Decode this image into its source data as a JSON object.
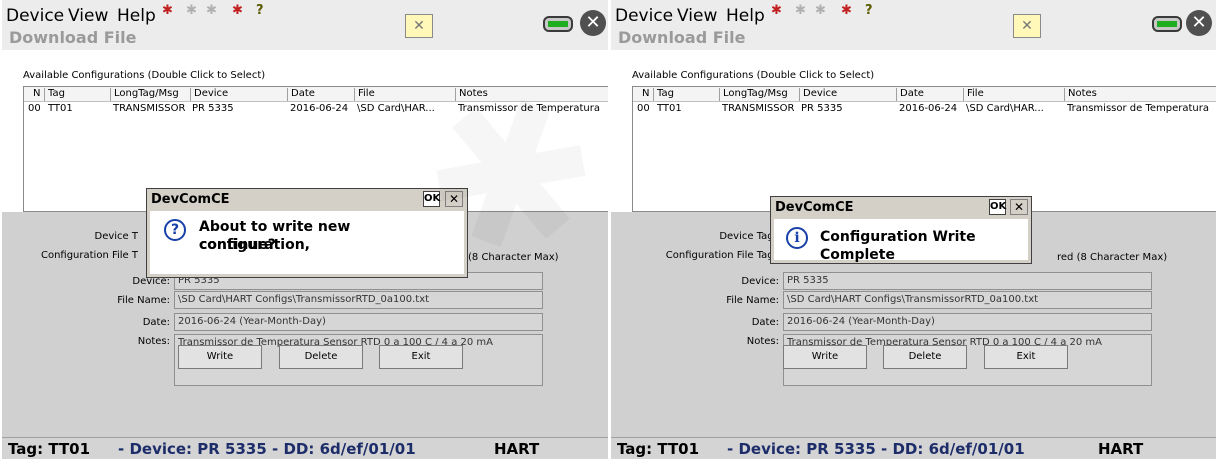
{
  "menu": {
    "device": "Device",
    "view": "View",
    "help": "Help"
  },
  "toolbar_icons": [
    "device-icon",
    "faded-icon",
    "faded-icon",
    "device-icon",
    "help-icon"
  ],
  "input_mode_symbol": "✕",
  "title": "Download File",
  "available_label": "Available Configurations (Double Click to Select)",
  "columns": [
    "N",
    "Tag",
    "LongTag/Msg",
    "Device",
    "Date",
    "File",
    "Notes"
  ],
  "row": [
    "00",
    "TT01",
    "TRANSMISSOR ...",
    "PR 5335",
    "2016-06-24",
    "\\SD Card\\HAR...",
    "Transmissor de Temperatura"
  ],
  "labels": {
    "device_tag": "Device Tag:",
    "config_file_tag": "Configuration File Tag:",
    "device": "Device:",
    "file_name": "File Name:",
    "date": "Date:",
    "notes": "Notes:"
  },
  "left_partial": {
    "device_tag": "Device T",
    "config_file_tag": "Configuration File T",
    "max_hint": "(8 Character Max)"
  },
  "right_partial": {
    "max_hint": "red (8 Character Max)"
  },
  "fields": {
    "device": "PR 5335",
    "file_name": "\\SD Card\\HART Configs\\TransmissorRTD_0a100.txt",
    "date": "2016-06-24 (Year-Month-Day)",
    "notes": "Transmissor de Temperatura Sensor RTD 0 a 100 C / 4 a 20 mA"
  },
  "buttons": {
    "write": "Write",
    "delete": "Delete",
    "exit": "Exit"
  },
  "status": {
    "tag": "Tag: TT01",
    "device": "- Device: PR 5335 - DD: 6d/ef/01/01",
    "protocol": "HART"
  },
  "dialog_left": {
    "title": "DevComCE",
    "ok": "OK",
    "close": "✕",
    "icon": "?",
    "line1": "About to write new configuration,",
    "line2": "continue?"
  },
  "dialog_right": {
    "title": "DevComCE",
    "ok": "OK",
    "close": "✕",
    "icon": "i",
    "message": "Configuration Write Complete"
  },
  "colors": {
    "background": "#d4d4d4",
    "dialog_icon": "#1740a8",
    "battery": "#1fae1f"
  }
}
